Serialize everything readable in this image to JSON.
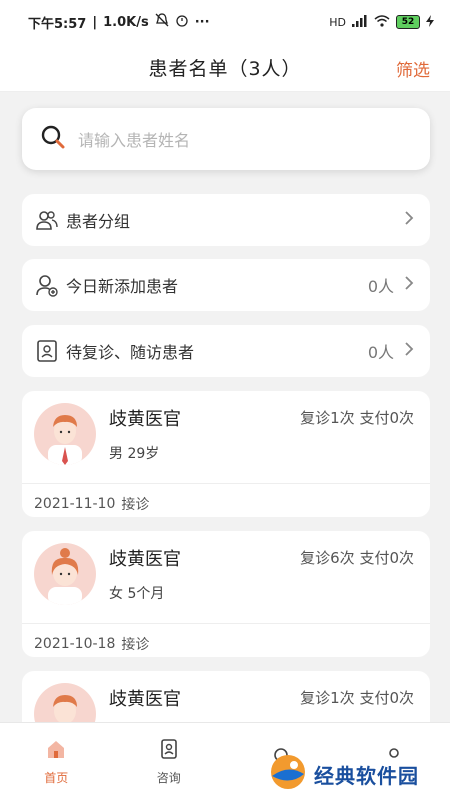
{
  "status_bar": {
    "time": "下午5:57",
    "network_speed": "1.0K/s",
    "signal": "HD",
    "battery": "52"
  },
  "header": {
    "title": "患者名单（3人）",
    "filter_label": "筛选"
  },
  "search": {
    "placeholder": "请输入患者姓名"
  },
  "menu": [
    {
      "label": "患者分组",
      "count": "",
      "icon": "group-icon"
    },
    {
      "label": "今日新添加患者",
      "count": "0人",
      "icon": "add-patient-icon"
    },
    {
      "label": "待复诊、随访患者",
      "count": "0人",
      "icon": "follow-up-icon"
    }
  ],
  "patients": [
    {
      "name": "歧黄医官",
      "gender_age": "男 29岁",
      "stats": "复诊1次 支付0次",
      "date": "2021-11-10",
      "action": "接诊",
      "avatar": "male-avatar"
    },
    {
      "name": "歧黄医官",
      "gender_age": "女 5个月",
      "stats": "复诊6次 支付0次",
      "date": "2021-10-18",
      "action": "接诊",
      "avatar": "female-avatar"
    },
    {
      "name": "歧黄医官",
      "gender_age": "",
      "stats": "复诊1次 支付0次",
      "date": "",
      "action": "",
      "avatar": "male-avatar"
    }
  ],
  "tabs": [
    {
      "label": "首页",
      "icon": "home-icon",
      "active": true
    },
    {
      "label": "咨询",
      "icon": "consult-icon",
      "active": false
    },
    {
      "label": "",
      "icon": "tab-3-icon",
      "active": false
    },
    {
      "label": "",
      "icon": "tab-4-icon",
      "active": false
    }
  ],
  "watermark": {
    "text": "经典软件园"
  },
  "colors": {
    "accent": "#e06a3a",
    "avatar_bg": "#f7d6cf",
    "background": "#f2f2f2"
  }
}
